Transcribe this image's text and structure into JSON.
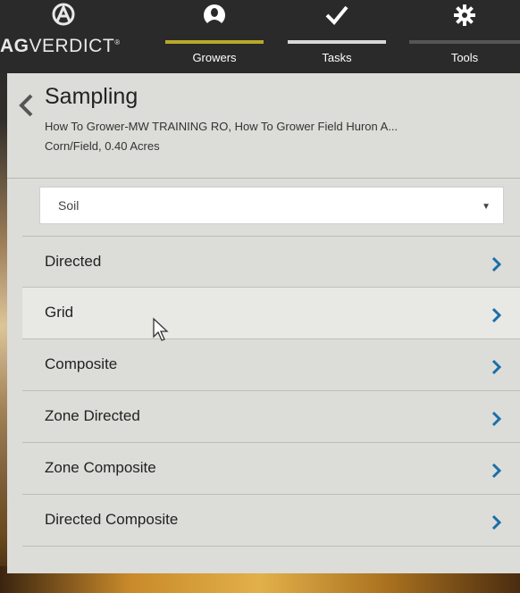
{
  "nav": {
    "logo_bold": "AG",
    "logo_rest": "VERDICT",
    "logo_mark": "®",
    "tabs": [
      {
        "label": "Growers",
        "icon": "person-icon",
        "active_color": "#b7a92a"
      },
      {
        "label": "Tasks",
        "icon": "checkmark-icon",
        "active_color": "#d8d8d8"
      },
      {
        "label": "Tools",
        "icon": "gear-icon",
        "active_color": "#555555"
      }
    ]
  },
  "header": {
    "title": "Sampling",
    "subtitle": "How To Grower-MW TRAINING RO, How To Grower Field Huron A...",
    "subtitle2": "Corn/Field, 0.40 Acres"
  },
  "select": {
    "value": "Soil"
  },
  "list": [
    {
      "label": "Directed"
    },
    {
      "label": "Grid"
    },
    {
      "label": "Composite"
    },
    {
      "label": "Zone Directed"
    },
    {
      "label": "Zone Composite"
    },
    {
      "label": "Directed Composite"
    }
  ],
  "colors": {
    "accent_chevron": "#1a6fa8"
  }
}
